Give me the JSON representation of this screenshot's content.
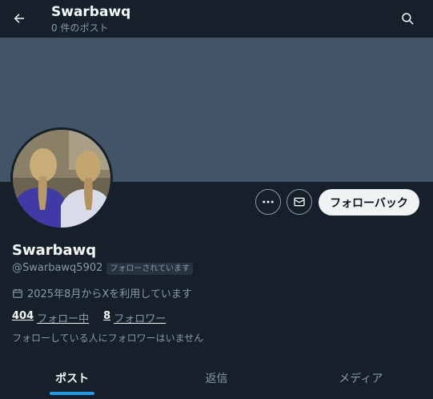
{
  "header": {
    "title": "Swarbawq",
    "subtitle": "0 件のポスト",
    "back_icon": "arrow-left-icon",
    "search_icon": "search-icon"
  },
  "profile": {
    "display_name": "Swarbawq",
    "handle": "@Swarbawq5902",
    "follows_you_badge": "フォローされています",
    "joined": "2025年8月からXを利用しています",
    "following_count": "404",
    "following_label": "フォロー中",
    "followers_count": "8",
    "followers_label": "フォロワー",
    "no_known_followers": "フォローしている人にフォロワーはいません"
  },
  "actions": {
    "more_icon": "more-dots-icon",
    "message_icon": "envelope-icon",
    "follow_back_label": "フォローバック"
  },
  "tabs": [
    {
      "label": "ポスト",
      "active": true
    },
    {
      "label": "返信",
      "active": false
    },
    {
      "label": "メディア",
      "active": false
    }
  ],
  "colors": {
    "background": "#15202b",
    "banner": "#425466",
    "accent": "#1d9bf0",
    "secondary_text": "#8b98a5"
  }
}
